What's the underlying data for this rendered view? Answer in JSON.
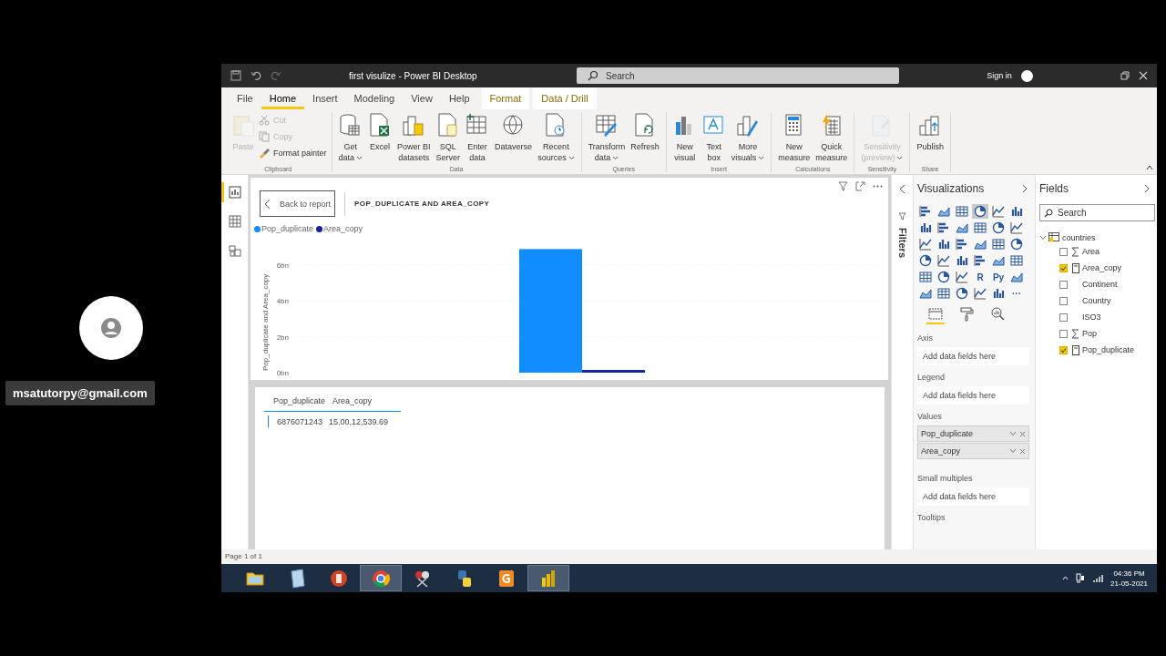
{
  "participant": {
    "email": "msatutorpy@gmail.com"
  },
  "window": {
    "title": "first visulize - Power BI Desktop",
    "search_placeholder": "Search",
    "sign_in": "Sign in"
  },
  "tabs": [
    {
      "label": "File",
      "kind": "normal",
      "selected": false
    },
    {
      "label": "Home",
      "kind": "normal",
      "selected": true
    },
    {
      "label": "Insert",
      "kind": "normal",
      "selected": false
    },
    {
      "label": "Modeling",
      "kind": "normal",
      "selected": false
    },
    {
      "label": "View",
      "kind": "normal",
      "selected": false
    },
    {
      "label": "Help",
      "kind": "normal",
      "selected": false
    },
    {
      "label": "Format",
      "kind": "contextual",
      "selected": false
    },
    {
      "label": "Data / Drill",
      "kind": "contextual",
      "selected": false
    }
  ],
  "ribbon": {
    "groups": [
      {
        "name": "Clipboard",
        "buttons": [
          {
            "kind": "large",
            "lines": [
              "Paste"
            ],
            "disabled": true
          },
          {
            "kind": "small",
            "lines": [
              "Cut"
            ],
            "disabled": true
          },
          {
            "kind": "small",
            "lines": [
              "Copy"
            ],
            "disabled": true
          },
          {
            "kind": "small",
            "lines": [
              "Format painter"
            ],
            "disabled": false
          }
        ]
      },
      {
        "name": "Data",
        "buttons": [
          {
            "kind": "large",
            "lines": [
              "Get",
              "data"
            ],
            "dropdown": true,
            "disabled": false
          },
          {
            "kind": "large",
            "lines": [
              "Excel"
            ],
            "disabled": false
          },
          {
            "kind": "large",
            "lines": [
              "Power BI",
              "datasets"
            ],
            "disabled": false
          },
          {
            "kind": "large",
            "lines": [
              "SQL",
              "Server"
            ],
            "disabled": false
          },
          {
            "kind": "large",
            "lines": [
              "Enter",
              "data"
            ],
            "disabled": false
          },
          {
            "kind": "large",
            "lines": [
              "Dataverse"
            ],
            "disabled": false
          },
          {
            "kind": "large",
            "lines": [
              "Recent",
              "sources"
            ],
            "dropdown": true,
            "disabled": false
          }
        ]
      },
      {
        "name": "Queries",
        "buttons": [
          {
            "kind": "large",
            "lines": [
              "Transform",
              "data"
            ],
            "dropdown": true,
            "disabled": false
          },
          {
            "kind": "large",
            "lines": [
              "Refresh"
            ],
            "disabled": false
          }
        ]
      },
      {
        "name": "Insert",
        "buttons": [
          {
            "kind": "large",
            "lines": [
              "New",
              "visual"
            ],
            "disabled": false
          },
          {
            "kind": "large",
            "lines": [
              "Text",
              "box"
            ],
            "disabled": false
          },
          {
            "kind": "large",
            "lines": [
              "More",
              "visuals"
            ],
            "dropdown": true,
            "disabled": false
          }
        ]
      },
      {
        "name": "Calculations",
        "buttons": [
          {
            "kind": "large",
            "lines": [
              "New",
              "measure"
            ],
            "disabled": false
          },
          {
            "kind": "large",
            "lines": [
              "Quick",
              "measure"
            ],
            "disabled": false
          }
        ]
      },
      {
        "name": "Sensitivity",
        "buttons": [
          {
            "kind": "large",
            "lines": [
              "Sensitivity",
              "(preview)"
            ],
            "dropdown": true,
            "disabled": true
          }
        ]
      },
      {
        "name": "Share",
        "buttons": [
          {
            "kind": "large",
            "lines": [
              "Publish"
            ],
            "disabled": false
          }
        ]
      }
    ]
  },
  "rail": [
    {
      "selected": true
    },
    {
      "selected": false
    },
    {
      "selected": false
    }
  ],
  "visual": {
    "back_button": "Back to report",
    "title": "POP_DUPLICATE AND AREA_COPY",
    "chart_data": {
      "type": "bar",
      "ylabel": "Pop_duplicate and Area_copy",
      "series": [
        {
          "name": "Pop_duplicate",
          "color": "#118dff",
          "values": [
            6880000000
          ]
        },
        {
          "name": "Area_copy",
          "color": "#12239e",
          "values": [
            150000000
          ]
        }
      ],
      "ylim": [
        0,
        7000000000
      ],
      "grid": true,
      "yticks": [
        {
          "value": 0,
          "label": "0bn"
        },
        {
          "value": 2000000000,
          "label": "2bn"
        },
        {
          "value": 4000000000,
          "label": "4bn"
        },
        {
          "value": 6000000000,
          "label": "6bn"
        }
      ]
    }
  },
  "table": {
    "columns": [
      "Pop_duplicate",
      "Area_copy"
    ],
    "rows": [
      [
        "6876071243",
        "15,00,12,539.69"
      ]
    ]
  },
  "filters": {
    "label": "Filters"
  },
  "visualizations": {
    "title": "Visualizations",
    "gallery": [
      {
        "selected": false
      },
      {
        "selected": false
      },
      {
        "selected": false
      },
      {
        "selected": true
      },
      {
        "selected": false
      },
      {
        "selected": false
      },
      {
        "selected": false
      },
      {
        "selected": false
      },
      {
        "selected": false
      },
      {
        "selected": false
      },
      {
        "selected": false
      },
      {
        "selected": false
      },
      {
        "selected": false
      },
      {
        "selected": false
      },
      {
        "selected": false
      },
      {
        "selected": false
      },
      {
        "selected": false
      },
      {
        "selected": false
      },
      {
        "selected": false
      },
      {
        "selected": false
      },
      {
        "selected": false
      },
      {
        "selected": false
      },
      {
        "selected": false
      },
      {
        "selected": false
      },
      {
        "selected": false
      },
      {
        "selected": false
      },
      {
        "selected": false
      },
      {
        "selected": false,
        "text": "R"
      },
      {
        "selected": false,
        "text": "Py"
      },
      {
        "selected": false
      },
      {
        "selected": false
      },
      {
        "selected": false
      },
      {
        "selected": false
      },
      {
        "selected": false
      },
      {
        "selected": false
      },
      {
        "selected": false,
        "text": "···"
      }
    ],
    "pane_tabs": [
      {
        "selected": true
      },
      {
        "selected": false
      },
      {
        "selected": false
      }
    ],
    "wells": [
      {
        "label": "Axis",
        "placeholder": "Add data fields here"
      },
      {
        "label": "Legend",
        "placeholder": "Add data fields here"
      },
      {
        "label": "Values",
        "fields": [
          "Pop_duplicate",
          "Area_copy"
        ]
      },
      {
        "label": "Small multiples",
        "placeholder": "Add data fields here"
      },
      {
        "label": "Tooltips"
      }
    ]
  },
  "fields": {
    "title": "Fields",
    "search_placeholder": "Search",
    "tables": [
      {
        "name": "countries",
        "expanded": true,
        "children": [
          {
            "name": "Area",
            "kind": "sum",
            "checked": false
          },
          {
            "name": "Area_copy",
            "kind": "measure",
            "checked": true
          },
          {
            "name": "Continent",
            "kind": "plain",
            "checked": false
          },
          {
            "name": "Country",
            "kind": "plain",
            "checked": false
          },
          {
            "name": "ISO3",
            "kind": "plain",
            "checked": false
          },
          {
            "name": "Pop",
            "kind": "sum",
            "checked": false
          },
          {
            "name": "Pop_duplicate",
            "kind": "measure",
            "checked": true
          }
        ]
      }
    ]
  },
  "status_bar": {
    "page": "Page 1 of 1"
  },
  "taskbar": {
    "apps": [
      {
        "selected": false
      },
      {
        "selected": false
      },
      {
        "selected": false
      },
      {
        "selected": true
      },
      {
        "selected": false
      },
      {
        "selected": false
      },
      {
        "selected": false
      },
      {
        "selected": true
      }
    ],
    "time": "04:36 PM",
    "date": "21-05-2021"
  }
}
